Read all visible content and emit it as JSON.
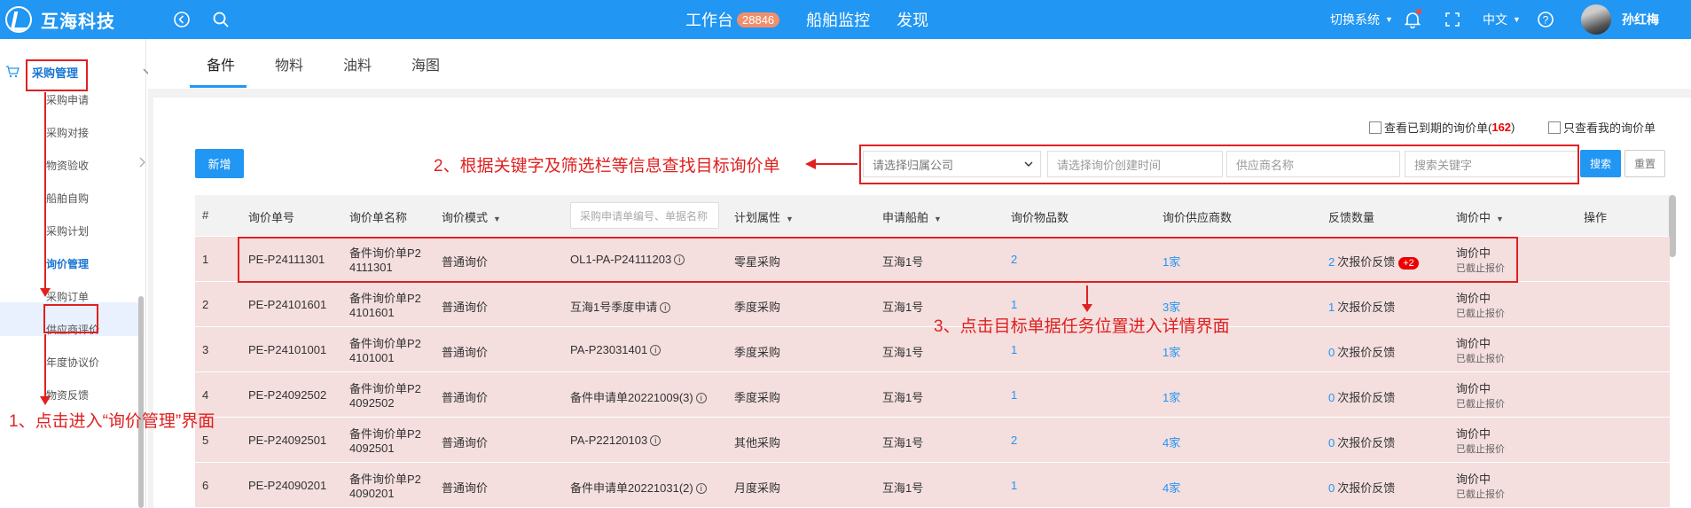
{
  "app": {
    "brand": "互海科技"
  },
  "topnav": {
    "workbench": "工作台",
    "workbench_count": "28846",
    "ship_monitor": "船舶监控",
    "discover": "发现"
  },
  "topright": {
    "switch_system": "切换系统",
    "language": "中文",
    "username": "孙红梅"
  },
  "sidebar": {
    "group": "采购管理",
    "items": [
      "采购申请",
      "采购对接",
      "物资验收",
      "船舶自购",
      "采购计划",
      "询价管理",
      "采购订单",
      "供应商评价",
      "年度协议价",
      "物资反馈"
    ]
  },
  "tabs": [
    "备件",
    "物料",
    "油料",
    "海图"
  ],
  "toolbar": {
    "expired_label": "查看已到期的询价单(",
    "expired_count": "162",
    "expired_close": ")",
    "mine_label": "只查看我的询价单",
    "add": "新增",
    "company_placeholder": "请选择归属公司",
    "time_placeholder": "请选择询价创建时间",
    "supplier_placeholder": "供应商名称",
    "keyword_placeholder": "搜索关键字",
    "search": "搜索",
    "reset": "重置"
  },
  "table": {
    "headers": {
      "index": "#",
      "code": "询价单号",
      "name": "询价单名称",
      "mode": "询价模式",
      "req_placeholder": "采购申请单编号、单据名称",
      "plan": "计划属性",
      "ship": "申请船舶",
      "items": "询价物品数",
      "suppliers": "询价供应商数",
      "feedback": "反馈数量",
      "status": "询价中",
      "op": "操作"
    },
    "rows": [
      {
        "idx": "1",
        "code": "PE-P24111301",
        "name1": "备件询价单P2",
        "name2": "4111301",
        "mode": "普通询价",
        "req": "OL1-PA-P24111203",
        "plan": "零星采购",
        "ship": "互海1号",
        "items": "2",
        "suppliers": "1家",
        "fb_num": "2",
        "fb_text": "次报价反馈",
        "fb_badge": "+2",
        "status": "询价中",
        "status_sub": "已截止报价"
      },
      {
        "idx": "2",
        "code": "PE-P24101601",
        "name1": "备件询价单P2",
        "name2": "4101601",
        "mode": "普通询价",
        "req": "互海1号季度申请",
        "plan": "季度采购",
        "ship": "互海1号",
        "items": "1",
        "suppliers": "3家",
        "fb_num": "1",
        "fb_text": "次报价反馈",
        "fb_badge": "",
        "status": "询价中",
        "status_sub": "已截止报价"
      },
      {
        "idx": "3",
        "code": "PE-P24101001",
        "name1": "备件询价单P2",
        "name2": "4101001",
        "mode": "普通询价",
        "req": "PA-P23031401",
        "plan": "季度采购",
        "ship": "互海1号",
        "items": "1",
        "suppliers": "1家",
        "fb_num": "0",
        "fb_text": "次报价反馈",
        "fb_badge": "",
        "status": "询价中",
        "status_sub": "已截止报价"
      },
      {
        "idx": "4",
        "code": "PE-P24092502",
        "name1": "备件询价单P2",
        "name2": "4092502",
        "mode": "普通询价",
        "req": "备件申请单20221009(3)",
        "plan": "季度采购",
        "ship": "互海1号",
        "items": "1",
        "suppliers": "1家",
        "fb_num": "0",
        "fb_text": "次报价反馈",
        "fb_badge": "",
        "status": "询价中",
        "status_sub": "已截止报价"
      },
      {
        "idx": "5",
        "code": "PE-P24092501",
        "name1": "备件询价单P2",
        "name2": "4092501",
        "mode": "普通询价",
        "req": "PA-P22120103",
        "plan": "其他采购",
        "ship": "互海1号",
        "items": "2",
        "suppliers": "4家",
        "fb_num": "0",
        "fb_text": "次报价反馈",
        "fb_badge": "",
        "status": "询价中",
        "status_sub": "已截止报价"
      },
      {
        "idx": "6",
        "code": "PE-P24090201",
        "name1": "备件询价单P2",
        "name2": "4090201",
        "mode": "普通询价",
        "req": "备件申请单20221031(2)",
        "plan": "月度采购",
        "ship": "互海1号",
        "items": "1",
        "suppliers": "4家",
        "fb_num": "0",
        "fb_text": "次报价反馈",
        "fb_badge": "",
        "status": "询价中",
        "status_sub": "已截止报价"
      }
    ]
  },
  "annotations": {
    "step1": "1、点击进入“询价管理”界面",
    "step2": "2、根据关键字及筛选栏等信息查找目标询价单",
    "step3": "3、点击目标单据任务位置进入详情界面"
  },
  "colors": {
    "brand": "#2196f3",
    "row_bg": "#f4dede",
    "annotation": "#e02020",
    "badge": "#f08f6e"
  }
}
